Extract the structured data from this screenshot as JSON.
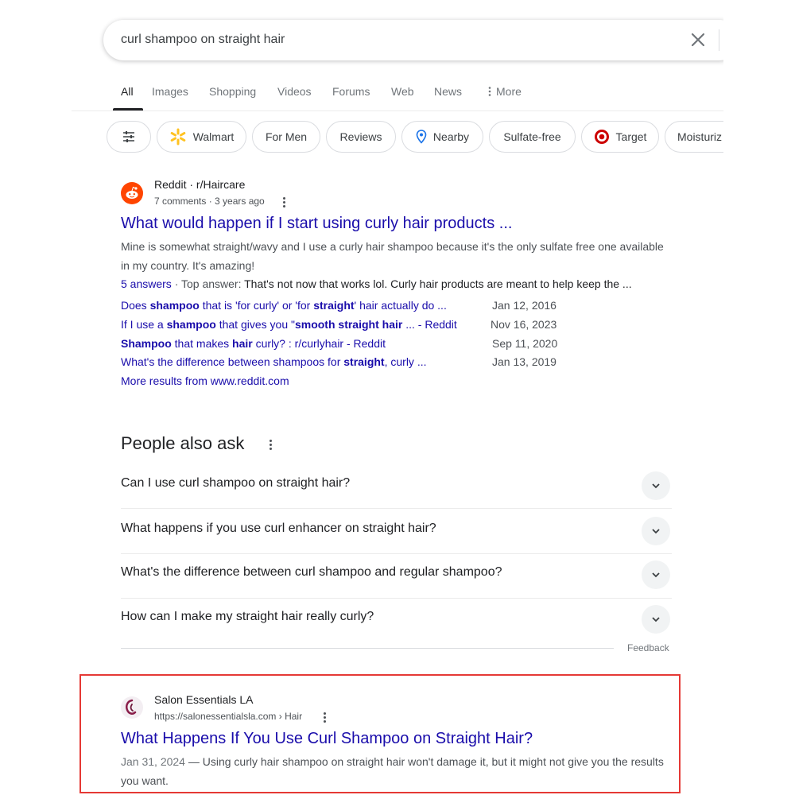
{
  "search": {
    "query": "curl shampoo on straight hair"
  },
  "tabs": [
    {
      "label": "All",
      "active": true
    },
    {
      "label": "Images"
    },
    {
      "label": "Shopping"
    },
    {
      "label": "Videos"
    },
    {
      "label": "Forums"
    },
    {
      "label": "Web"
    },
    {
      "label": "News"
    },
    {
      "label": "More"
    }
  ],
  "chips": [
    {
      "label": "Walmart",
      "icon": "walmart-icon"
    },
    {
      "label": "For Men"
    },
    {
      "label": "Reviews"
    },
    {
      "label": "Nearby",
      "icon": "location-pin-icon"
    },
    {
      "label": "Sulfate-free"
    },
    {
      "label": "Target",
      "icon": "target-icon"
    },
    {
      "label": "Moisturiz"
    }
  ],
  "colors": {
    "link": "#1a0dab",
    "highlight": "#e53935",
    "reddit": "#ff4500",
    "walmart_yellow": "#ffc220",
    "target_red": "#cc0000",
    "pin_blue": "#1a73e8"
  },
  "reddit_result": {
    "site_name": "Reddit · r/Haircare",
    "meta": "7 comments · 3 years ago",
    "title": "What would happen if I start using curly hair products ...",
    "snippet": "Mine is somewhat straight/wavy and I use a curly hair shampoo because it's the only sulfate free one available in my country. It's amazing!",
    "answers_label": "5 answers",
    "top_answer_label": " · Top answer: ",
    "top_answer_text": "That's not now that works lol. Curly hair products are meant to help keep the ...",
    "sitelinks": [
      {
        "pre": "Does ",
        "b1": "shampoo",
        "mid": " that is 'for curly' or 'for ",
        "b2": "straight",
        "post": "' hair actually do ...",
        "date": "Jan 12, 2016"
      },
      {
        "pre": "If I use a ",
        "b1": "shampoo",
        "mid": " that gives you \"",
        "b2": "smooth straight hair",
        "post": " ... - Reddit",
        "date": "Nov 16, 2023"
      },
      {
        "pre": "",
        "b1": "Shampoo",
        "mid": " that makes ",
        "b2": "hair",
        "post": " curly? : r/curlyhair - Reddit",
        "date": "Sep 11, 2020"
      },
      {
        "pre": "What's the difference between shampoos for ",
        "b1": "straight",
        "mid": ", curly ...",
        "b2": "",
        "post": "",
        "date": "Jan 13, 2019"
      }
    ],
    "more_results": "More results from www.reddit.com"
  },
  "people_also_ask": {
    "heading": "People also ask",
    "questions": [
      "Can I use curl shampoo on straight hair?",
      "What happens if you use curl enhancer on straight hair?",
      "What's the difference between curl shampoo and regular shampoo?",
      "How can I make my straight hair really curly?"
    ],
    "feedback": "Feedback"
  },
  "salon_result": {
    "site_name": "Salon Essentials LA",
    "url": "https://salonessentialsla.com › Hair",
    "title": "What Happens If You Use Curl Shampoo on Straight Hair?",
    "date": "Jan 31, 2024",
    "snippet": " — Using curly hair shampoo on straight hair won't damage it, but it might not give you the results you want."
  }
}
